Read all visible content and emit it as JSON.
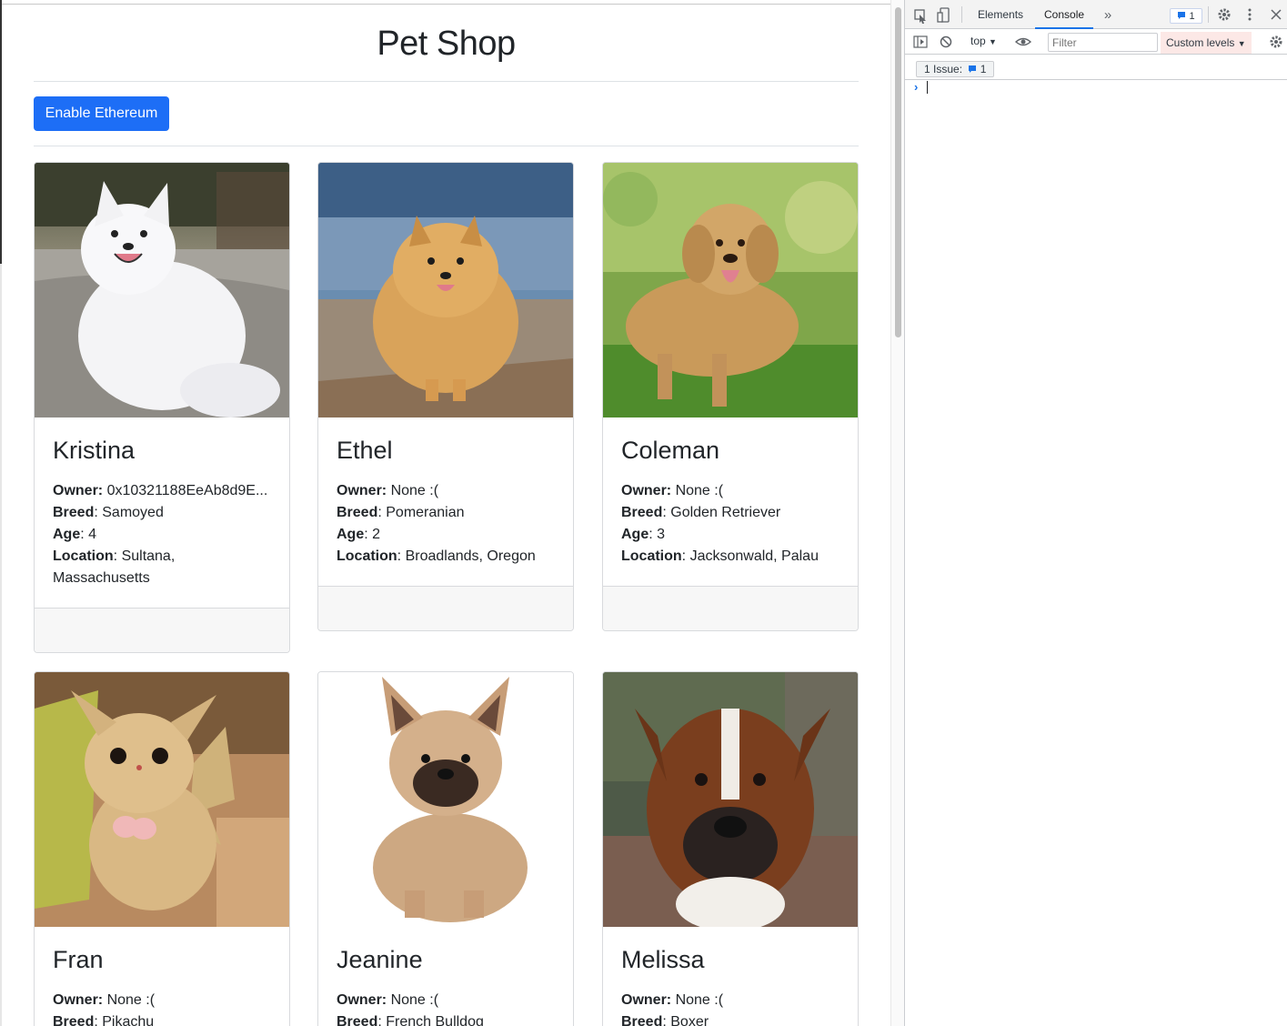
{
  "page": {
    "title": "Pet Shop",
    "enable_button": "Enable Ethereum"
  },
  "labels": {
    "owner": "Owner:",
    "breed": "Breed",
    "age": "Age",
    "location": "Location"
  },
  "pets": [
    {
      "name": "Kristina",
      "owner": " 0x10321188EeAb8d9E...",
      "breed": "Samoyed",
      "age": "4",
      "location": "Sultana, Massachusetts"
    },
    {
      "name": "Ethel",
      "owner": " None :(",
      "breed": "Pomeranian",
      "age": "2",
      "location": "Broadlands, Oregon"
    },
    {
      "name": "Coleman",
      "owner": " None :(",
      "breed": "Golden Retriever",
      "age": "3",
      "location": "Jacksonwald, Palau"
    },
    {
      "name": "Fran",
      "owner": " None :(",
      "breed": "Pikachu"
    },
    {
      "name": "Jeanine",
      "owner": " None :(",
      "breed": "French Bulldog"
    },
    {
      "name": "Melissa",
      "owner": " None :(",
      "breed": "Boxer"
    }
  ],
  "devtools": {
    "tabs": [
      "Elements",
      "Console"
    ],
    "active_tab": "Console",
    "issue_count": "1",
    "context": "top",
    "filter_placeholder": "Filter",
    "levels": "Custom levels",
    "issues_label": "1 Issue:",
    "issues_count": "1",
    "accent": "#1a73e8"
  }
}
